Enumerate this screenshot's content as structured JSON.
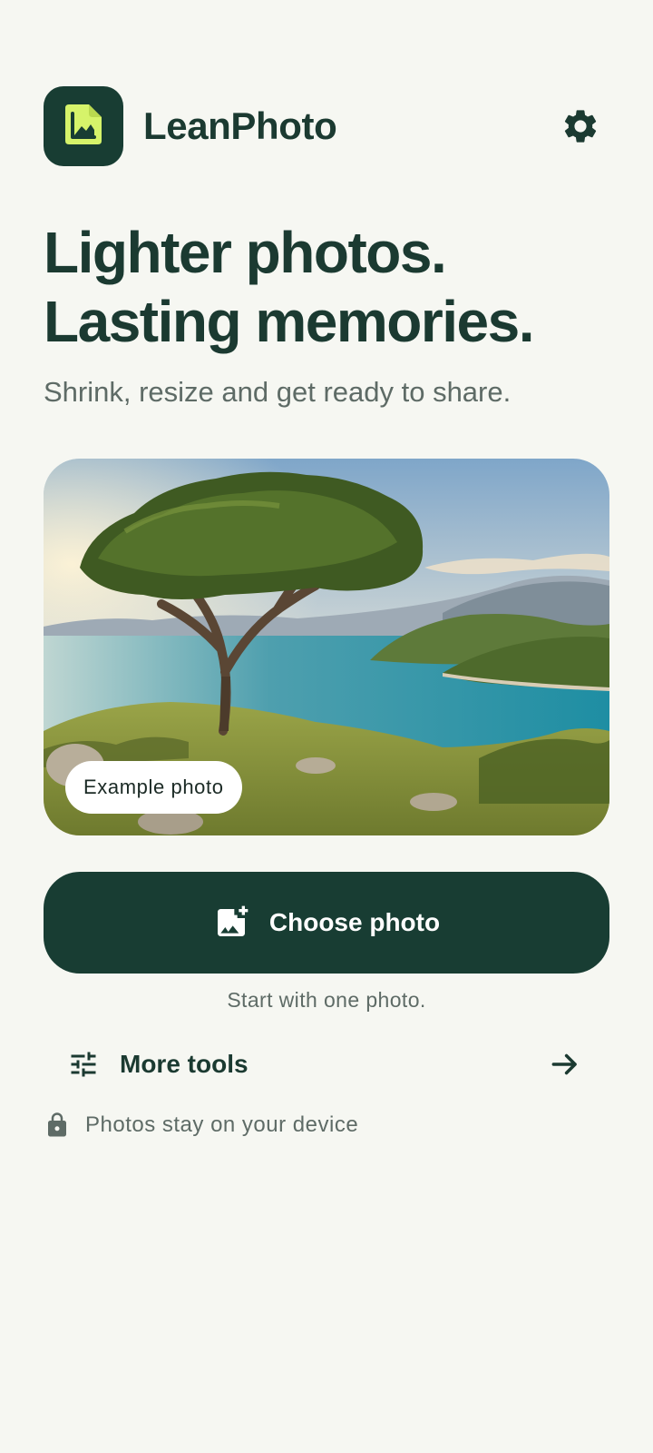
{
  "app": {
    "name": "LeanPhoto",
    "icon": "photo-file-icon",
    "settings_icon": "gear-icon"
  },
  "hero": {
    "headline_line1": "Lighter photos.",
    "headline_line2": "Lasting memories.",
    "subtitle": "Shrink, resize and get ready to share."
  },
  "preview": {
    "image": "coastal landscape with umbrella pine tree",
    "chip_label": "Example photo"
  },
  "primary_action": {
    "label": "Choose photo",
    "icon": "add-photo-icon",
    "hint": "Start with one photo."
  },
  "secondary_action": {
    "label": "More tools",
    "icon": "tune-icon",
    "trailing_icon": "arrow-right-icon"
  },
  "privacy": {
    "icon": "lock-icon",
    "text": "Photos stay on your device"
  },
  "colors": {
    "background": "#F6F7F2",
    "brand_dark": "#183D33",
    "brand_accent": "#D6F36A",
    "text_primary": "#1B3A31",
    "text_secondary": "#5E6B66"
  }
}
